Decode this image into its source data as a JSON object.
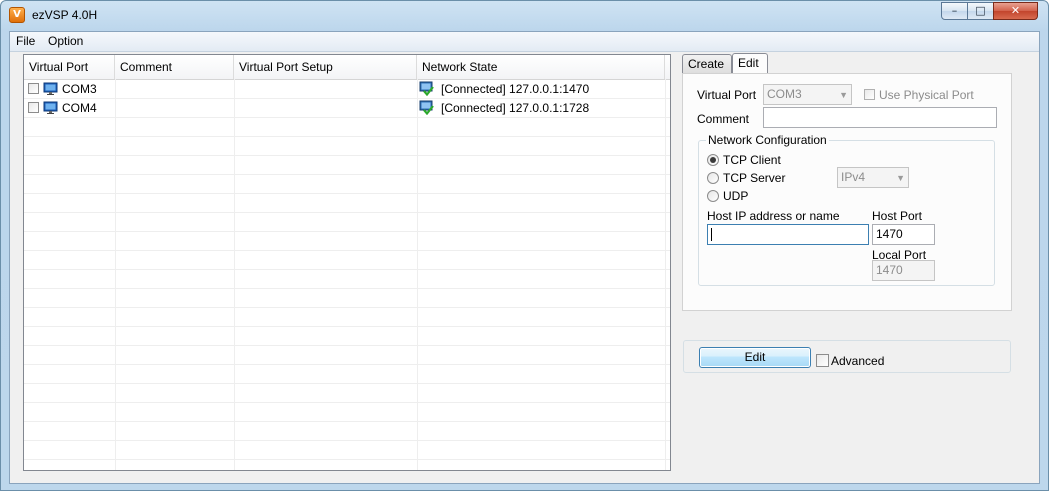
{
  "window": {
    "title": "ezVSP 4.0H",
    "app_icon_letter": "V",
    "controls": {
      "minimize": "–",
      "maximize": "□",
      "close": "✕"
    }
  },
  "menu": {
    "items": [
      "File",
      "Option"
    ]
  },
  "port_list": {
    "columns": [
      "Virtual Port",
      "Comment",
      "Virtual Port Setup",
      "Network State"
    ],
    "rows": [
      {
        "port": "COM3",
        "comment": "",
        "setup": "",
        "network_state": "[Connected] 127.0.0.1:1470"
      },
      {
        "port": "COM4",
        "comment": "",
        "setup": "",
        "network_state": "[Connected] 127.0.0.1:1728"
      }
    ]
  },
  "tabs": {
    "create": "Create",
    "edit": "Edit",
    "active": "Edit"
  },
  "edit_form": {
    "virtual_port_label": "Virtual Port",
    "virtual_port_value": "COM3",
    "use_physical_port_label": "Use Physical Port",
    "comment_label": "Comment",
    "comment_value": "",
    "network_config_title": "Network Configuration",
    "mode_tcp_client": "TCP Client",
    "mode_tcp_server": "TCP Server",
    "mode_udp": "UDP",
    "selected_mode": "TCP Client",
    "ip_version_value": "IPv4",
    "host_ip_label": "Host IP address or name",
    "host_ip_value": "",
    "host_port_label": "Host Port",
    "host_port_value": "1470",
    "local_port_label": "Local Port",
    "local_port_value": "1470"
  },
  "actions": {
    "edit_button": "Edit",
    "advanced_label": "Advanced"
  }
}
